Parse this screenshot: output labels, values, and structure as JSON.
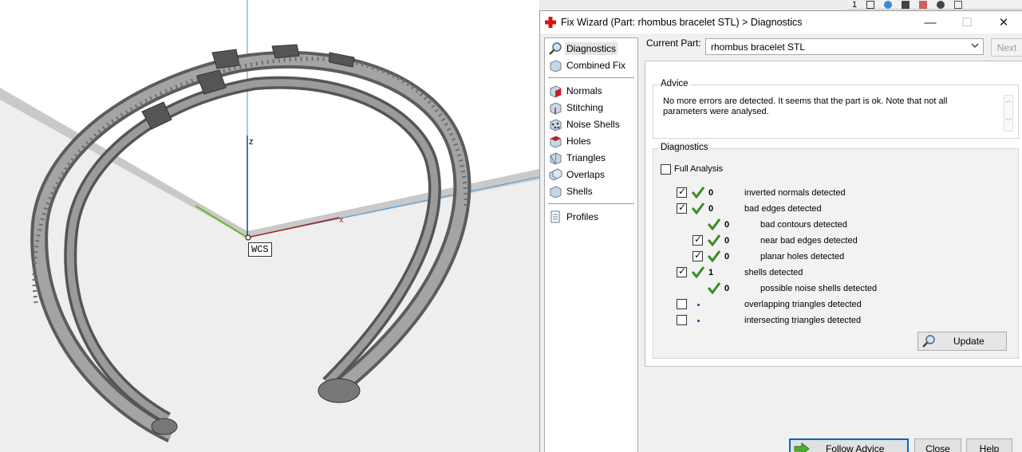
{
  "viewport": {
    "wcs_label": "WCS",
    "axis_z": "z",
    "axis_x": "x"
  },
  "mini_toolbar": {
    "value": "1"
  },
  "dialog": {
    "title": "Fix Wizard (Part: rhombus bracelet STL) > Diagnostics",
    "window_buttons": {
      "minimize": "—",
      "maximize": "☐",
      "close": "✕"
    },
    "nav": {
      "top": [
        {
          "label": "Diagnostics",
          "icon": "magnifier-icon",
          "selected": true
        },
        {
          "label": "Combined Fix",
          "icon": "cube-fix-icon"
        }
      ],
      "tools": [
        {
          "label": "Normals",
          "icon": "normals-cube-icon"
        },
        {
          "label": "Stitching",
          "icon": "stitching-cube-icon"
        },
        {
          "label": "Noise Shells",
          "icon": "noise-shells-icon"
        },
        {
          "label": "Holes",
          "icon": "holes-cube-icon"
        },
        {
          "label": "Triangles",
          "icon": "triangles-icon"
        },
        {
          "label": "Overlaps",
          "icon": "overlaps-icon"
        },
        {
          "label": "Shells",
          "icon": "shells-icon"
        }
      ],
      "bottom": [
        {
          "label": "Profiles",
          "icon": "document-icon"
        }
      ]
    },
    "current_part_label": "Current Part:",
    "current_part_value": "rhombus bracelet STL",
    "next_label": "Next",
    "advice": {
      "title": "Advice",
      "text": "No more errors are detected. It seems that the part is ok. Note that not all parameters were analysed."
    },
    "diagnostics": {
      "title": "Diagnostics",
      "full_analysis_label": "Full Analysis",
      "full_analysis_checked": false,
      "rows": [
        {
          "checked": true,
          "status": "ok",
          "count": "0",
          "label": "inverted normals detected"
        },
        {
          "checked": true,
          "status": "ok",
          "count": "0",
          "label": "bad edges detected"
        },
        {
          "checked": null,
          "status": "ok",
          "count": "0",
          "label": "bad contours detected"
        },
        {
          "checked": true,
          "status": "ok",
          "count": "0",
          "label": "near bad edges detected"
        },
        {
          "checked": true,
          "status": "ok",
          "count": "0",
          "label": "planar holes detected"
        },
        {
          "checked": true,
          "status": "ok",
          "count": "1",
          "label": "shells detected"
        },
        {
          "checked": null,
          "status": "ok",
          "count": "0",
          "label": "possible noise shells detected"
        },
        {
          "checked": false,
          "status": "none",
          "count": "",
          "label": "overlapping triangles detected"
        },
        {
          "checked": false,
          "status": "none",
          "count": "",
          "label": "intersecting triangles detected"
        }
      ],
      "update_label": "Update"
    },
    "buttons": {
      "follow_advice": "Follow Advice",
      "close": "Close",
      "help": "Help"
    }
  },
  "colors": {
    "check_green": "#3b8a2a",
    "accent_blue": "#0a64c8",
    "mesh_gray": "#8a8a8a"
  }
}
